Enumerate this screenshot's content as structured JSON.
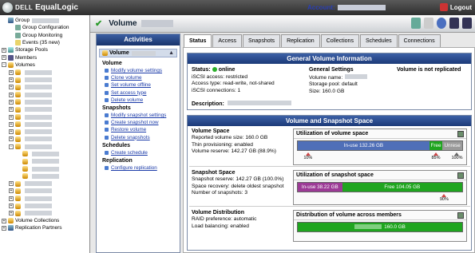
{
  "header": {
    "brand": "EqualLogic",
    "dell": "DELL",
    "account_label": "Account:",
    "logout": "Logout"
  },
  "tree": {
    "items": [
      {
        "label": "Group",
        "indent": 0,
        "exp": "",
        "icon": "grp",
        "blur": true
      },
      {
        "label": "Group Configuration",
        "indent": 1,
        "exp": "",
        "icon": "cfg"
      },
      {
        "label": "Group Monitoring",
        "indent": 1,
        "exp": "",
        "icon": "cfg"
      },
      {
        "label": "Events (35 new)",
        "indent": 1,
        "exp": "",
        "icon": "ev"
      },
      {
        "label": "Storage Pools",
        "indent": 0,
        "exp": "+",
        "icon": "pool"
      },
      {
        "label": "Members",
        "indent": 0,
        "exp": "+",
        "icon": "mem"
      },
      {
        "label": "Volumes",
        "indent": 0,
        "exp": "-",
        "icon": "vol"
      },
      {
        "label": "",
        "indent": 1,
        "exp": "+",
        "icon": "vol",
        "blur": true
      },
      {
        "label": "",
        "indent": 1,
        "exp": "+",
        "icon": "vol",
        "blur": true
      },
      {
        "label": "",
        "indent": 1,
        "exp": "+",
        "icon": "vol",
        "blur": true
      },
      {
        "label": "",
        "indent": 1,
        "exp": "+",
        "icon": "vol",
        "blur": true
      },
      {
        "label": "",
        "indent": 1,
        "exp": "+",
        "icon": "vol",
        "blur": true
      },
      {
        "label": "",
        "indent": 1,
        "exp": "+",
        "icon": "vol",
        "blur": true
      },
      {
        "label": "",
        "indent": 1,
        "exp": "+",
        "icon": "vol",
        "blur": true
      },
      {
        "label": "",
        "indent": 1,
        "exp": "+",
        "icon": "vol",
        "blur": true
      },
      {
        "label": "",
        "indent": 1,
        "exp": "+",
        "icon": "vol",
        "blur": true
      },
      {
        "label": "",
        "indent": 1,
        "exp": "+",
        "icon": "vol",
        "blur": true
      },
      {
        "label": "",
        "indent": 1,
        "exp": "-",
        "icon": "vol",
        "blur": true
      },
      {
        "label": "",
        "indent": 2,
        "exp": "",
        "icon": "vol",
        "blur": true
      },
      {
        "label": "",
        "indent": 2,
        "exp": "",
        "icon": "vol",
        "blur": true
      },
      {
        "label": "",
        "indent": 2,
        "exp": "",
        "icon": "vol",
        "blur": true
      },
      {
        "label": "",
        "indent": 2,
        "exp": "",
        "icon": "vol",
        "blur": true
      },
      {
        "label": "",
        "indent": 1,
        "exp": "+",
        "icon": "vol",
        "blur": true
      },
      {
        "label": "",
        "indent": 1,
        "exp": "+",
        "icon": "vol",
        "blur": true
      },
      {
        "label": "",
        "indent": 1,
        "exp": "+",
        "icon": "vol",
        "blur": true
      },
      {
        "label": "",
        "indent": 1,
        "exp": "+",
        "icon": "vol",
        "blur": true
      },
      {
        "label": "",
        "indent": 1,
        "exp": "+",
        "icon": "vol",
        "blur": true
      },
      {
        "label": "Volume Collections",
        "indent": 0,
        "exp": "+",
        "icon": "vol"
      },
      {
        "label": "Replication Partners",
        "indent": 0,
        "exp": "+",
        "icon": "grp"
      }
    ]
  },
  "title": {
    "label": "Volume"
  },
  "activities": {
    "header": "Activities",
    "selected": "Volume",
    "sections": [
      {
        "title": "Volume",
        "links": [
          "Modify volume settings",
          "Clone volume",
          "Set volume offline",
          "Set access type",
          "Delete volume"
        ]
      },
      {
        "title": "Snapshots",
        "links": [
          "Modify snapshot settings",
          "Create snapshot now",
          "Restore volume",
          "Delete snapshots"
        ]
      },
      {
        "title": "Schedules",
        "links": [
          "Create schedule"
        ]
      },
      {
        "title": "Replication",
        "links": [
          "Configure replication"
        ]
      }
    ]
  },
  "tabs": [
    "Status",
    "Access",
    "Snapshots",
    "Replication",
    "Collections",
    "Schedules",
    "Connections"
  ],
  "general": {
    "header": "General Volume Information",
    "status_label": "Status:",
    "status_value": "online",
    "iscsi_access": "iSCSI access:  restricted",
    "access_type": "Access type:  read-write, not-shared",
    "iscsi_conn": "iSCSI connections:  1",
    "settings_title": "General Settings",
    "volume_name": "Volume name:",
    "storage_pool": "Storage pool:  default",
    "size": "Size:  160.0 GB",
    "replicated": "Volume is not replicated",
    "description": "Description:"
  },
  "space": {
    "header": "Volume and Snapshot Space",
    "vol_title": "Volume Space",
    "vol_lines": [
      "Reported volume size:  160.0 GB",
      "Thin provisioning:  enabled",
      "Volume reserve:  142.27 GB (88.9%)"
    ],
    "vol_util_title": "Utilization of volume space",
    "vol_inuse": "In-use 132.26 GB",
    "vol_free": "Free",
    "vol_unres": "Unrese",
    "vol_marks": [
      "10%",
      "85%",
      "100%"
    ],
    "snap_title": "Snapshot Space",
    "snap_lines": [
      "Snapshot reserve:  142.27 GB (100.0%)",
      "Space recovery:  delete oldest snapshot",
      "Number of snapshots:  3"
    ],
    "snap_util_title": "Utilization of snapshot space",
    "snap_inuse": "In-use 38.22 GB",
    "snap_free": "Free 104.05 GB",
    "snap_mark": "90%",
    "dist_title": "Volume Distribution",
    "dist_lines": [
      "RAID preference:  automatic",
      "Load balancing:  enabled"
    ],
    "dist_util_title": "Distribution of volume across members",
    "dist_value": "160.0 GB"
  },
  "colors": {
    "accent": "#1c3a78",
    "inuse": "#4f6fb8",
    "free": "#1fa51f",
    "unres": "#9a9a9a",
    "snap_inuse": "#9c3a96"
  }
}
